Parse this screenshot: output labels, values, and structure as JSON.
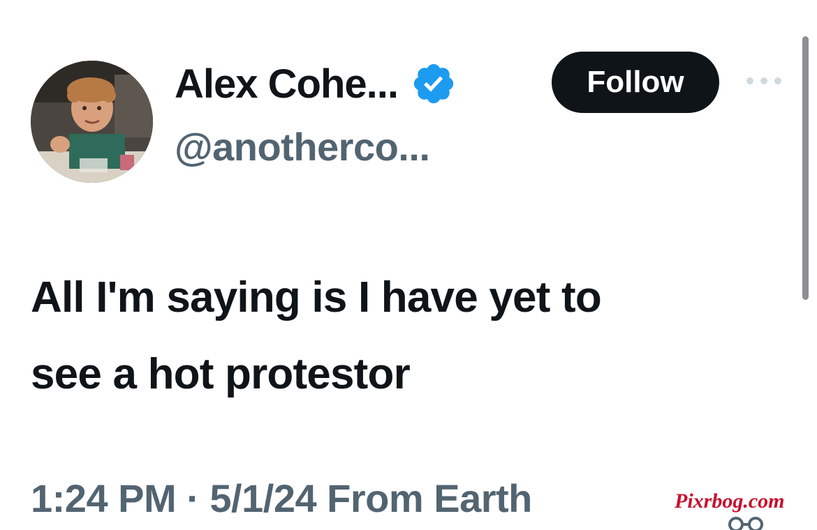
{
  "tweet": {
    "author": {
      "display_name": "Alex Cohe...",
      "handle": "@anotherco...",
      "verified": true,
      "avatar_icon": "profile-photo"
    },
    "follow_label": "Follow",
    "more_icon": "more-horizontal-icon",
    "text_lines": [
      "All I'm saying is I have yet to",
      "see a hot protestor"
    ],
    "meta": "1:24 PM · 5/1/24 From Earth"
  },
  "watermark": "Pixrbog.com",
  "colors": {
    "text_primary": "#0f1419",
    "text_secondary": "#536471",
    "verified_blue": "#1d9bf0",
    "follow_bg": "#0f1419",
    "watermark_red": "#c8102e"
  }
}
